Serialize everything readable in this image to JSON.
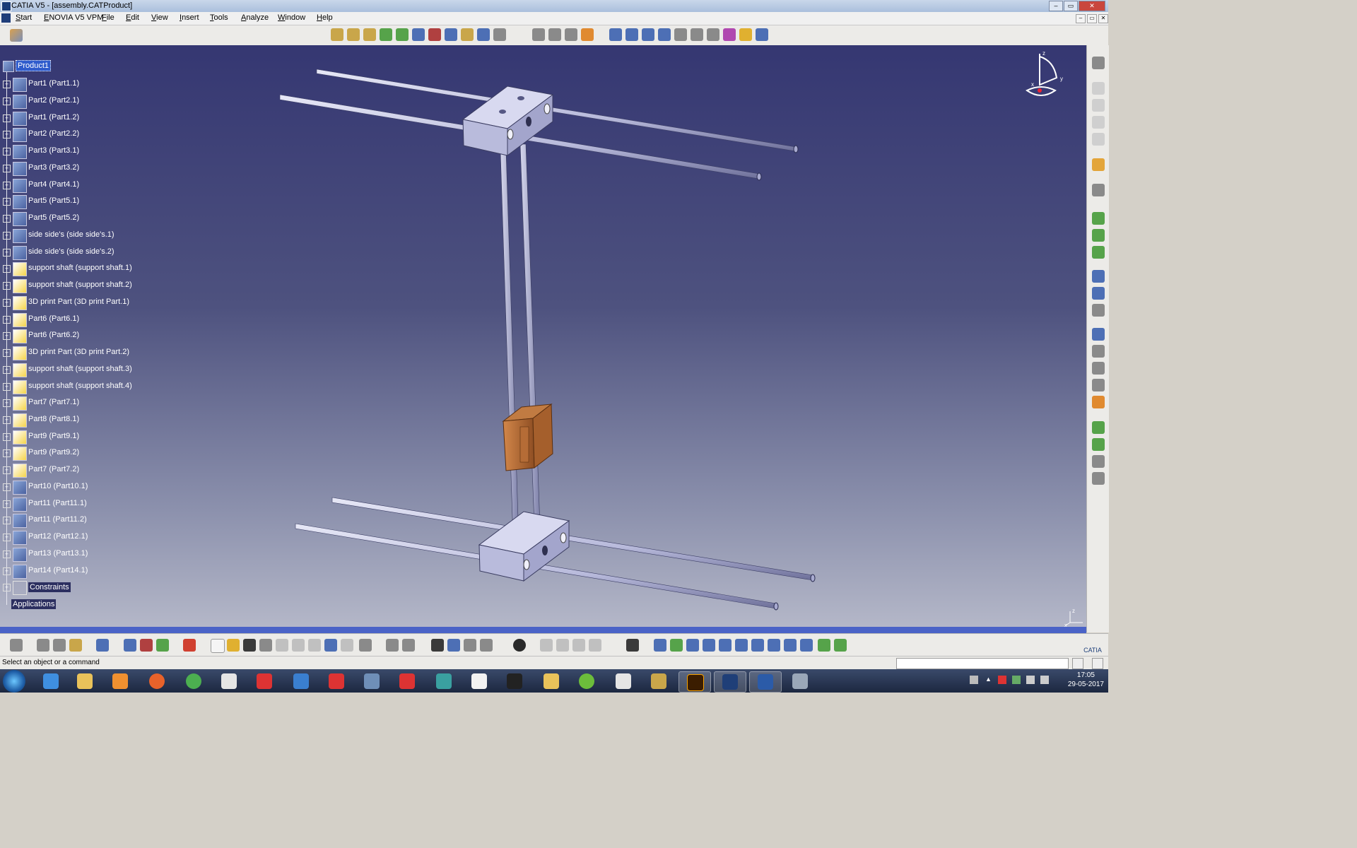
{
  "window": {
    "title": "CATIA V5 - [assembly.CATProduct]",
    "buttons": {
      "minimize": "–",
      "restore": "▭",
      "close": "✕"
    }
  },
  "menu": {
    "items": [
      "Start",
      "ENOVIA V5 VPM",
      "File",
      "Edit",
      "View",
      "Insert",
      "Tools",
      "Analyze",
      "Window",
      "Help"
    ]
  },
  "tree": {
    "root": "Product1",
    "nodes": [
      {
        "label": "Part1 (Part1.1)",
        "icon": "part-icon"
      },
      {
        "label": "Part2 (Part2.1)",
        "icon": "part-icon"
      },
      {
        "label": "Part1 (Part1.2)",
        "icon": "part-icon"
      },
      {
        "label": "Part2 (Part2.2)",
        "icon": "part-icon"
      },
      {
        "label": "Part3 (Part3.1)",
        "icon": "part-icon"
      },
      {
        "label": "Part3 (Part3.2)",
        "icon": "part-icon"
      },
      {
        "label": "Part4 (Part4.1)",
        "icon": "part-icon"
      },
      {
        "label": "Part5 (Part5.1)",
        "icon": "part-icon"
      },
      {
        "label": "Part5 (Part5.2)",
        "icon": "part-icon"
      },
      {
        "label": "side side's (side side's.1)",
        "icon": "part-icon"
      },
      {
        "label": "side side's (side side's.2)",
        "icon": "part-icon"
      },
      {
        "label": "support shaft (support shaft.1)",
        "icon": "product-icon"
      },
      {
        "label": "support shaft (support shaft.2)",
        "icon": "product-icon"
      },
      {
        "label": "3D print Part (3D print Part.1)",
        "icon": "product-icon"
      },
      {
        "label": "Part6 (Part6.1)",
        "icon": "product-icon"
      },
      {
        "label": "Part6 (Part6.2)",
        "icon": "product-icon"
      },
      {
        "label": "3D print Part (3D print Part.2)",
        "icon": "product-icon"
      },
      {
        "label": "support shaft (support shaft.3)",
        "icon": "product-icon"
      },
      {
        "label": "support shaft (support shaft.4)",
        "icon": "product-icon"
      },
      {
        "label": "Part7 (Part7.1)",
        "icon": "product-icon"
      },
      {
        "label": "Part8 (Part8.1)",
        "icon": "product-icon"
      },
      {
        "label": "Part9 (Part9.1)",
        "icon": "product-icon"
      },
      {
        "label": "Part9 (Part9.2)",
        "icon": "product-icon"
      },
      {
        "label": "Part7 (Part7.2)",
        "icon": "product-icon"
      },
      {
        "label": "Part10 (Part10.1)",
        "icon": "part-icon"
      },
      {
        "label": "Part11 (Part11.1)",
        "icon": "part-icon"
      },
      {
        "label": "Part11 (Part11.2)",
        "icon": "part-icon"
      },
      {
        "label": "Part12 (Part12.1)",
        "icon": "part-icon"
      },
      {
        "label": "Part13 (Part13.1)",
        "icon": "part-icon"
      },
      {
        "label": "Part14 (Part14.1)",
        "icon": "part-icon"
      }
    ],
    "constraints": "Constraints",
    "applications": "Applications"
  },
  "compass": {
    "x": "x",
    "y": "y",
    "z": "z"
  },
  "status": {
    "message": "Select an object or a command"
  },
  "clock": {
    "time": "17:05",
    "date": "29-05-2017"
  },
  "colors": {
    "viewport_top": "#353772",
    "viewport_bottom": "#b4b7c8",
    "selection": "#2f5ccc",
    "model_part": "#c7c8e8",
    "printed_part": "#c47a3c"
  }
}
